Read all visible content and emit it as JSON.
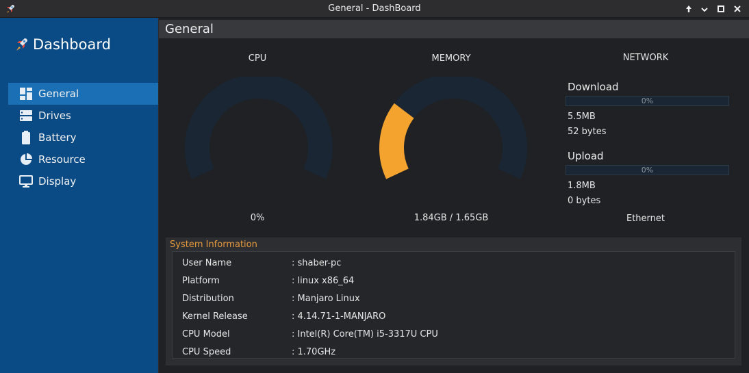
{
  "window": {
    "title": "General - DashBoard"
  },
  "sidebar": {
    "brand": "Dashboard",
    "items": [
      {
        "label": "General",
        "icon": "grid-icon",
        "active": true
      },
      {
        "label": "Drives",
        "icon": "drives-icon",
        "active": false
      },
      {
        "label": "Battery",
        "icon": "battery-icon",
        "active": false
      },
      {
        "label": "Resource",
        "icon": "pie-chart-icon",
        "active": false
      },
      {
        "label": "Display",
        "icon": "monitor-icon",
        "active": false
      }
    ]
  },
  "page": {
    "title": "General"
  },
  "cpu": {
    "title": "CPU",
    "value_label": "0%",
    "percent": 0
  },
  "memory": {
    "title": "MEMORY",
    "value_label": "1.84GB / 1.65GB",
    "percent": 27
  },
  "network": {
    "title": "NETWORK",
    "download": {
      "label": "Download",
      "progress_text": "0%",
      "percent": 0,
      "total": "5.5MB",
      "rate": "52 bytes"
    },
    "upload": {
      "label": "Upload",
      "progress_text": "0%",
      "percent": 0,
      "total": "1.8MB",
      "rate": "0 bytes"
    },
    "interface": "Ethernet"
  },
  "sysinfo": {
    "legend": "System Information",
    "rows": [
      {
        "key": "User Name",
        "value": ": shaber-pc"
      },
      {
        "key": "Platform",
        "value": ": linux x86_64"
      },
      {
        "key": "Distribution",
        "value": ": Manjaro Linux"
      },
      {
        "key": "Kernel Release",
        "value": ": 4.14.71-1-MANJARO"
      },
      {
        "key": "CPU Model",
        "value": ": Intel(R) Core(TM) i5-3317U CPU"
      },
      {
        "key": "CPU Speed",
        "value": ": 1.70GHz"
      }
    ]
  },
  "colors": {
    "sidebar": "#0b4b85",
    "active": "#1a6fb5",
    "gauge_track": "#1a2633",
    "gauge_fill": "#f5a32f",
    "accent": "#e79a3c"
  }
}
